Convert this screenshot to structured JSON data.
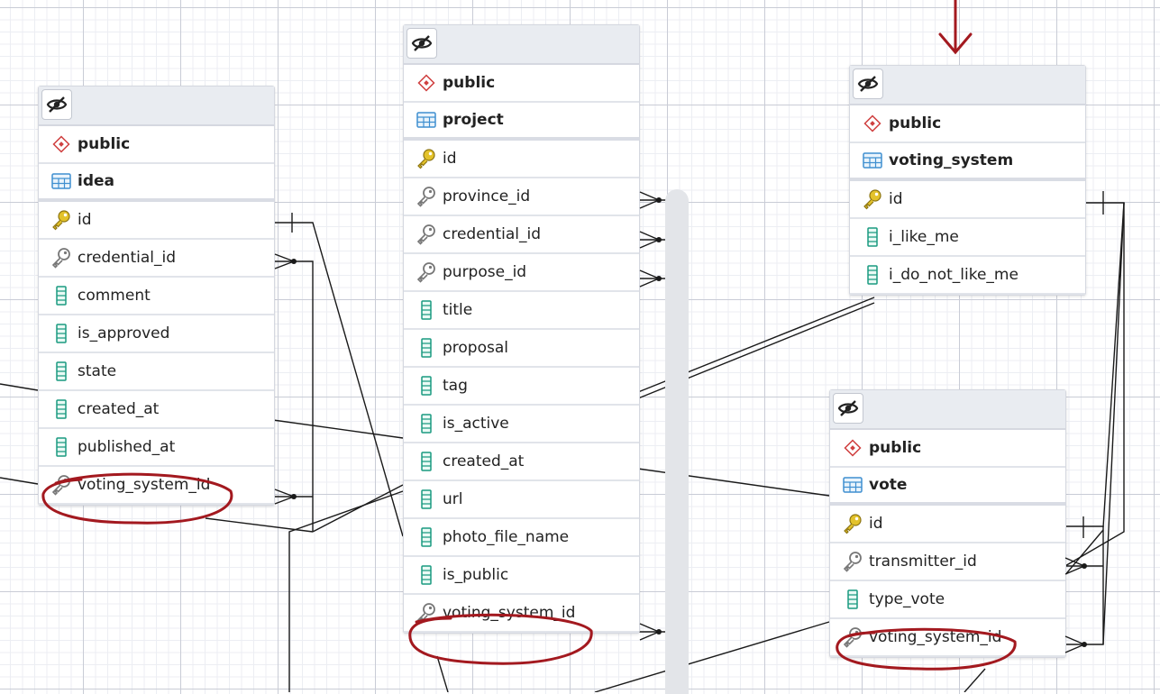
{
  "tables": [
    {
      "id": "idea",
      "schema": "public",
      "name": "idea",
      "columns": [
        {
          "name": "id",
          "icon": "primary-key-icon"
        },
        {
          "name": "credential_id",
          "icon": "foreign-key-icon"
        },
        {
          "name": "comment",
          "icon": "column-icon"
        },
        {
          "name": "is_approved",
          "icon": "column-icon"
        },
        {
          "name": "state",
          "icon": "column-icon"
        },
        {
          "name": "created_at",
          "icon": "column-icon"
        },
        {
          "name": "published_at",
          "icon": "column-icon"
        },
        {
          "name": "voting_system_id",
          "icon": "foreign-key-icon",
          "circled": true
        }
      ]
    },
    {
      "id": "project",
      "schema": "public",
      "name": "project",
      "columns": [
        {
          "name": "id",
          "icon": "primary-key-icon"
        },
        {
          "name": "province_id",
          "icon": "foreign-key-icon"
        },
        {
          "name": "credential_id",
          "icon": "foreign-key-icon"
        },
        {
          "name": "purpose_id",
          "icon": "foreign-key-icon"
        },
        {
          "name": "title",
          "icon": "column-icon"
        },
        {
          "name": "proposal",
          "icon": "column-icon"
        },
        {
          "name": "tag",
          "icon": "column-icon"
        },
        {
          "name": "is_active",
          "icon": "column-icon"
        },
        {
          "name": "created_at",
          "icon": "column-icon"
        },
        {
          "name": "url",
          "icon": "column-icon"
        },
        {
          "name": "photo_file_name",
          "icon": "column-icon"
        },
        {
          "name": "is_public",
          "icon": "column-icon"
        },
        {
          "name": "voting_system_id",
          "icon": "foreign-key-icon",
          "circled": true
        }
      ]
    },
    {
      "id": "voting_system",
      "schema": "public",
      "name": "voting_system",
      "columns": [
        {
          "name": "id",
          "icon": "primary-key-icon"
        },
        {
          "name": "i_like_me",
          "icon": "column-icon"
        },
        {
          "name": "i_do_not_like_me",
          "icon": "column-icon"
        }
      ]
    },
    {
      "id": "vote",
      "schema": "public",
      "name": "vote",
      "columns": [
        {
          "name": "id",
          "icon": "primary-key-icon"
        },
        {
          "name": "transmitter_id",
          "icon": "foreign-key-icon"
        },
        {
          "name": "type_vote",
          "icon": "column-icon"
        },
        {
          "name": "voting_system_id",
          "icon": "foreign-key-icon",
          "circled": true
        }
      ]
    }
  ],
  "icons": {
    "header_button": "eye-slash-icon",
    "schema": "schema-diamond-icon",
    "table": "table-grid-icon"
  },
  "colors": {
    "annotation": "#a3191f",
    "primary_key": "#e3c22b",
    "foreign_key": "#8a8a8a",
    "column": "#1a9a80",
    "schema": "#d04040",
    "table": "#3f8fd0",
    "link": "#1a1a1a"
  }
}
